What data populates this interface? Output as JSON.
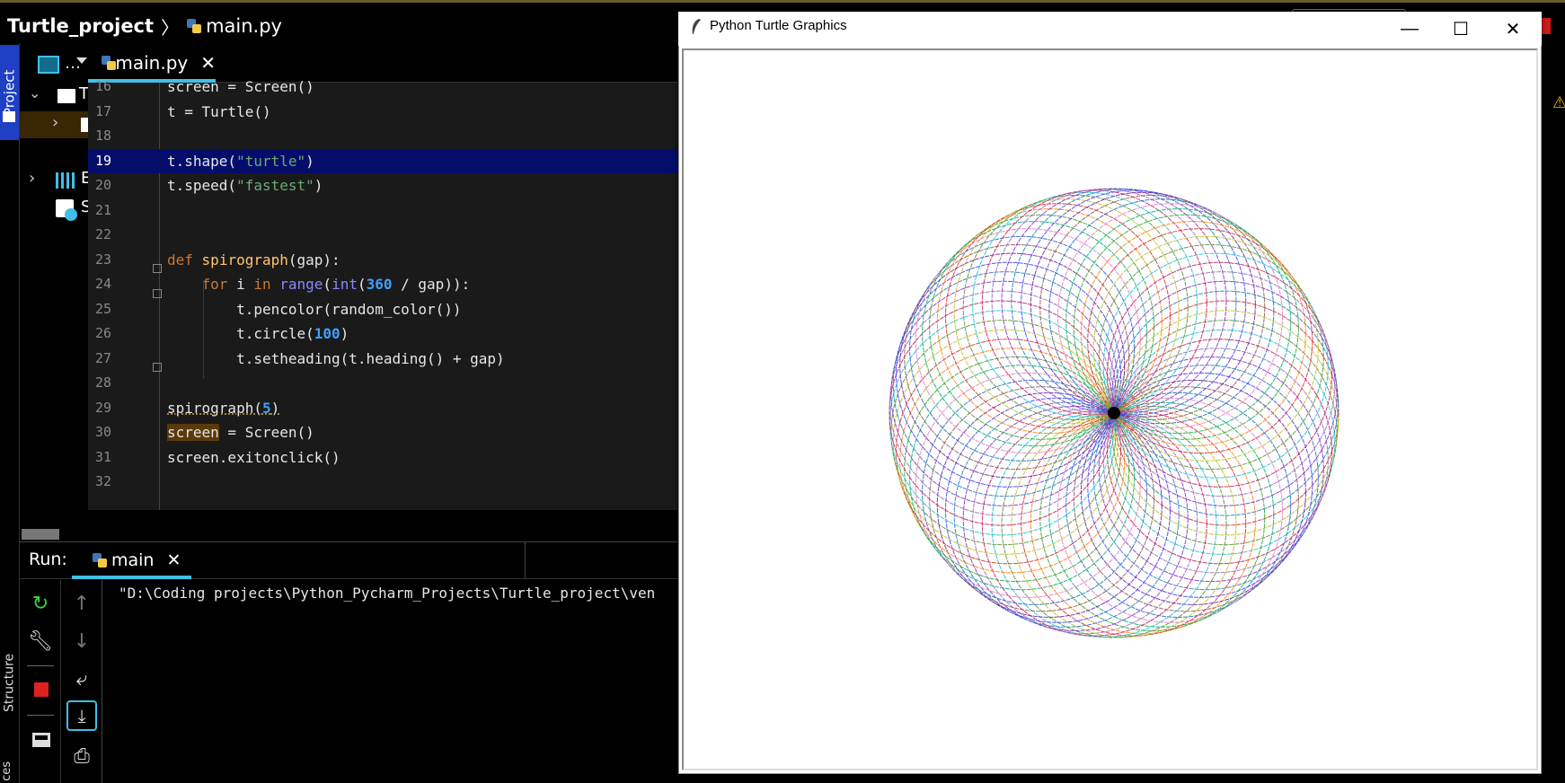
{
  "ide": {
    "project_name": "Turtle_project",
    "separator": "〉",
    "file_name": "main.py",
    "side_tabs": {
      "project": "Project",
      "structure": "Structure",
      "favorites_fragment": "ces"
    },
    "project_header_ellipsis": "…",
    "tree_fragments": [
      "T",
      "E",
      "S"
    ]
  },
  "editor": {
    "active_tab": "main.py",
    "close_glyph": "✕",
    "current_line": 19,
    "lines": [
      {
        "n": "16",
        "text": "screen = Screen()"
      },
      {
        "n": "17",
        "text": "t = Turtle()"
      },
      {
        "n": "18",
        "text": ""
      },
      {
        "n": "19",
        "text": "t.shape(\"turtle\")"
      },
      {
        "n": "20",
        "text": "t.speed(\"fastest\")"
      },
      {
        "n": "21",
        "text": ""
      },
      {
        "n": "22",
        "text": ""
      },
      {
        "n": "23",
        "text": "def spirograph(gap):"
      },
      {
        "n": "24",
        "text": "    for i in range(int(360 / gap)):"
      },
      {
        "n": "25",
        "text": "        t.pencolor(random_color())"
      },
      {
        "n": "26",
        "text": "        t.circle(100)"
      },
      {
        "n": "27",
        "text": "        t.setheading(t.heading() + gap)"
      },
      {
        "n": "28",
        "text": ""
      },
      {
        "n": "29",
        "text": "spirograph(5)"
      },
      {
        "n": "30",
        "text": "screen = Screen()"
      },
      {
        "n": "31",
        "text": "screen.exitonclick()"
      },
      {
        "n": "32",
        "text": ""
      }
    ]
  },
  "run": {
    "label": "Run:",
    "tab_label": "main",
    "console_output": "\"D:\\Coding projects\\Python_Pycharm_Projects\\Turtle_project\\ven"
  },
  "turtle_window": {
    "title": "Python Turtle Graphics",
    "minimize": "—",
    "maximize": "☐",
    "close": "✕",
    "spirograph": {
      "gap_degrees": 5,
      "circle_count": 72
    }
  },
  "colors": {
    "accent_underline": "#3fc0e8",
    "current_line_bg": "#050d6b",
    "project_tab_bg": "#1f3fc4",
    "keyword": "#cc7832",
    "function": "#ffc66d",
    "string": "#6aab73",
    "number": "#3fa0ff"
  }
}
